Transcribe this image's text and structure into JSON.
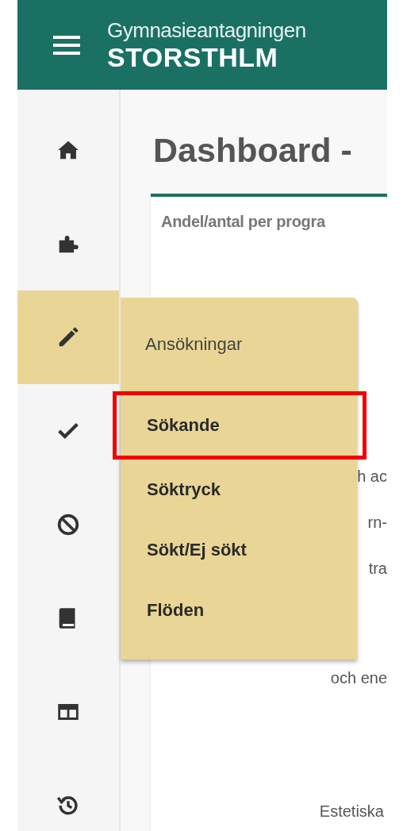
{
  "header": {
    "logo_line_1": "Gymnasieantagningen",
    "logo_line_2": "STORSTHLM"
  },
  "sidebar": {
    "items": [
      {
        "selected": false
      },
      {
        "selected": false
      },
      {
        "selected": true
      },
      {
        "selected": false
      },
      {
        "selected": false
      },
      {
        "selected": false
      },
      {
        "selected": false
      },
      {
        "selected": false
      }
    ]
  },
  "flyout": {
    "title": "Ansökningar",
    "items": [
      {
        "label": "Sökande",
        "highlighted": true
      },
      {
        "label": "Söktryck",
        "highlighted": false
      },
      {
        "label": "Sökt/Ej sökt",
        "highlighted": false
      },
      {
        "label": "Flöden",
        "highlighted": false
      }
    ]
  },
  "page_title": "Dashboard -",
  "card": {
    "title": "Andel/antal per progra",
    "fragments": [
      "h ac",
      "rn-",
      "tra",
      "och ene",
      "Estetiska"
    ]
  }
}
